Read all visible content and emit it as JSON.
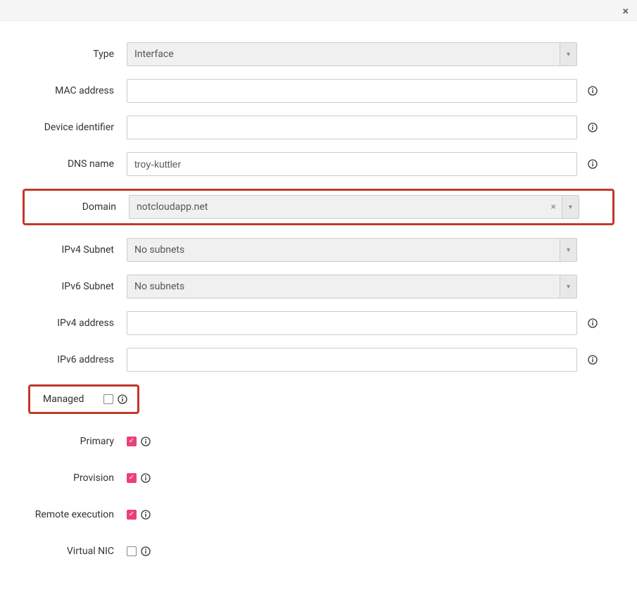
{
  "header": {
    "close_symbol": "×"
  },
  "fields": {
    "type": {
      "label": "Type",
      "value": "Interface"
    },
    "mac": {
      "label": "MAC address",
      "value": ""
    },
    "device_id": {
      "label": "Device identifier",
      "value": ""
    },
    "dns": {
      "label": "DNS name",
      "value": "troy-kuttler"
    },
    "domain": {
      "label": "Domain",
      "value": "notcloudapp.net"
    },
    "ipv4_subnet": {
      "label": "IPv4 Subnet",
      "value": "No subnets"
    },
    "ipv6_subnet": {
      "label": "IPv6 Subnet",
      "value": "No subnets"
    },
    "ipv4_addr": {
      "label": "IPv4 address",
      "value": ""
    },
    "ipv6_addr": {
      "label": "IPv6 address",
      "value": ""
    },
    "managed": {
      "label": "Managed",
      "checked": false
    },
    "primary": {
      "label": "Primary",
      "checked": true
    },
    "provision": {
      "label": "Provision",
      "checked": true
    },
    "remote_exec": {
      "label": "Remote execution",
      "checked": true
    },
    "virtual_nic": {
      "label": "Virtual NIC",
      "checked": false
    }
  },
  "icons": {
    "clear": "×",
    "caret": "▾"
  }
}
